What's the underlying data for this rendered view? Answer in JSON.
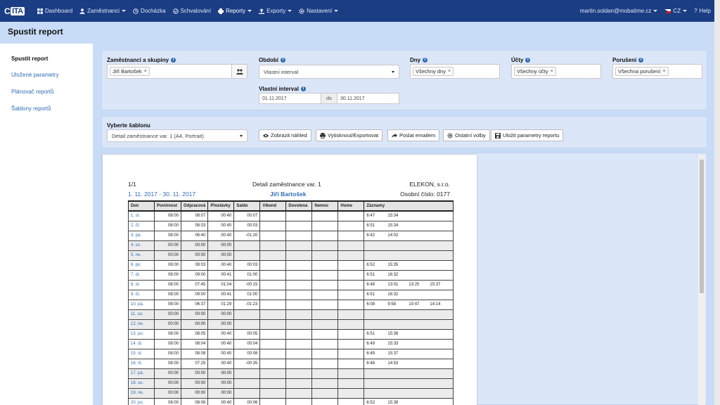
{
  "topbar": {
    "logo_text": "ITA",
    "nav": [
      {
        "label": "Dashboard",
        "icon": "dashboard-icon",
        "caret": false
      },
      {
        "label": "Zaměstnanci",
        "icon": "user-icon",
        "caret": true
      },
      {
        "label": "Docházka",
        "icon": "clock-icon",
        "caret": false
      },
      {
        "label": "Schvalování",
        "icon": "check-circle-icon",
        "caret": false
      },
      {
        "label": "Reporty",
        "icon": "print-icon",
        "caret": true
      },
      {
        "label": "Exporty",
        "icon": "upload-icon",
        "caret": true
      },
      {
        "label": "Nastavení",
        "icon": "gear-icon",
        "caret": true
      }
    ],
    "user": "martin.soldan@mobatime.cz",
    "lang": "CZ",
    "help": "Help"
  },
  "page_title": "Spustit report",
  "sidebar": {
    "items": [
      {
        "label": "Spustit report",
        "active": true
      },
      {
        "label": "Uložené parametry",
        "active": false
      },
      {
        "label": "Plánovač reportů",
        "active": false
      },
      {
        "label": "Šablony reportů",
        "active": false
      }
    ]
  },
  "filters": {
    "employees_label": "Zaměstnanci a skupiny",
    "employees_tag": "Jiří Bartošek",
    "period_label": "Období",
    "period_value": "Vlastní interval",
    "days_label": "Dny",
    "days_tag": "Všechny dny",
    "accounts_label": "Účty",
    "accounts_tag": "Všechny účty",
    "violations_label": "Porušení",
    "violations_tag": "Všechna porušení",
    "custom_interval_label": "Vlastní interval",
    "date_from": "01.11.2017",
    "date_sep": "do",
    "date_to": "30.11.2017"
  },
  "template": {
    "label": "Vyberte šablonu",
    "value": "Detail zaměstnance var. 1 (A4, Portrait)"
  },
  "actions": {
    "preview": "Zobrazit náhled",
    "print": "Vytisknout/Exportovat",
    "email": "Poslat emailem",
    "other": "Ostatní volby",
    "save": "Uložit parametry reportu"
  },
  "report": {
    "page": "1/1",
    "title": "Detail zaměstnance var. 1",
    "company": "ELEKON, s.r.o.",
    "range": "1. 11. 2017 - 30. 11. 2017",
    "employee": "Jiří Bartošek",
    "personal_no": "Osobní číslo: 0177",
    "columns": [
      "Den",
      "Povinnost",
      "Odpracová",
      "Přestávky",
      "Saldo",
      "Víkend",
      "Dovolená",
      "Nemoc",
      "Home",
      "Záznamy"
    ],
    "rows": [
      {
        "day": "1. st.",
        "pov": "08:00",
        "odp": "08:07",
        "pre": "00:40",
        "saldo": "00:07",
        "wk": false,
        "z": [
          "6:47",
          "15:34"
        ]
      },
      {
        "day": "2. čt.",
        "pov": "08:00",
        "odp": "08:03",
        "pre": "00:40",
        "saldo": "00:03",
        "wk": false,
        "z": [
          "6:51",
          "15:34"
        ]
      },
      {
        "day": "3. pá.",
        "pov": "08:00",
        "odp": "06:40",
        "pre": "00:40",
        "saldo": "-01:20",
        "wk": false,
        "z": [
          "6:42",
          "14:02"
        ]
      },
      {
        "day": "4. so.",
        "pov": "00:00",
        "odp": "00:00",
        "pre": "00:00",
        "saldo": "",
        "wk": true,
        "z": []
      },
      {
        "day": "5. ne.",
        "pov": "00:00",
        "odp": "00:00",
        "pre": "00:00",
        "saldo": "",
        "wk": true,
        "z": []
      },
      {
        "day": "6. po.",
        "pov": "08:00",
        "odp": "08:03",
        "pre": "00:40",
        "saldo": "00:03",
        "wk": false,
        "z": [
          "6:52",
          "15:35"
        ]
      },
      {
        "day": "7. út.",
        "pov": "08:00",
        "odp": "09:00",
        "pre": "00:41",
        "saldo": "01:00",
        "wk": false,
        "z": [
          "6:51",
          "16:32"
        ]
      },
      {
        "day": "8. st.",
        "pov": "08:00",
        "odp": "07:45",
        "pre": "01:04",
        "saldo": "-00:15",
        "wk": false,
        "z": [
          "6:48",
          "13:01",
          "13:25",
          "15:37"
        ]
      },
      {
        "day": "9. čt.",
        "pov": "08:00",
        "odp": "09:00",
        "pre": "00:41",
        "saldo": "01:00",
        "wk": false,
        "z": [
          "6:51",
          "16:32"
        ]
      },
      {
        "day": "10. pá.",
        "pov": "08:00",
        "odp": "06:37",
        "pre": "01:29",
        "saldo": "-01:23",
        "wk": false,
        "z": [
          "6:08",
          "9:58",
          "10:47",
          "14:14"
        ]
      },
      {
        "day": "11. so.",
        "pov": "00:00",
        "odp": "00:00",
        "pre": "00:00",
        "saldo": "",
        "wk": true,
        "z": []
      },
      {
        "day": "12. ne.",
        "pov": "00:00",
        "odp": "00:00",
        "pre": "00:00",
        "saldo": "",
        "wk": true,
        "z": []
      },
      {
        "day": "13. po.",
        "pov": "08:00",
        "odp": "08:05",
        "pre": "00:40",
        "saldo": "00:05",
        "wk": false,
        "z": [
          "6:51",
          "15:36"
        ]
      },
      {
        "day": "14. út.",
        "pov": "08:00",
        "odp": "08:04",
        "pre": "00:40",
        "saldo": "00:04",
        "wk": false,
        "z": [
          "6:49",
          "15:33"
        ]
      },
      {
        "day": "15. st.",
        "pov": "08:00",
        "odp": "08:08",
        "pre": "00:40",
        "saldo": "00:08",
        "wk": false,
        "z": [
          "6:49",
          "15:37"
        ]
      },
      {
        "day": "16. čt.",
        "pov": "08:00",
        "odp": "07:25",
        "pre": "00:40",
        "saldo": "-00:35",
        "wk": false,
        "z": [
          "6:48",
          "14:53"
        ]
      },
      {
        "day": "17. pá.",
        "pov": "00:00",
        "odp": "00:00",
        "pre": "00:00",
        "saldo": "",
        "wk": true,
        "z": []
      },
      {
        "day": "18. so.",
        "pov": "00:00",
        "odp": "00:00",
        "pre": "00:00",
        "saldo": "",
        "wk": true,
        "z": []
      },
      {
        "day": "19. ne.",
        "pov": "00:00",
        "odp": "00:00",
        "pre": "00:00",
        "saldo": "",
        "wk": true,
        "z": []
      },
      {
        "day": "20. po.",
        "pov": "08:00",
        "odp": "08:06",
        "pre": "00:40",
        "saldo": "00:06",
        "wk": false,
        "z": [
          "6:52",
          "15:38"
        ]
      }
    ]
  }
}
